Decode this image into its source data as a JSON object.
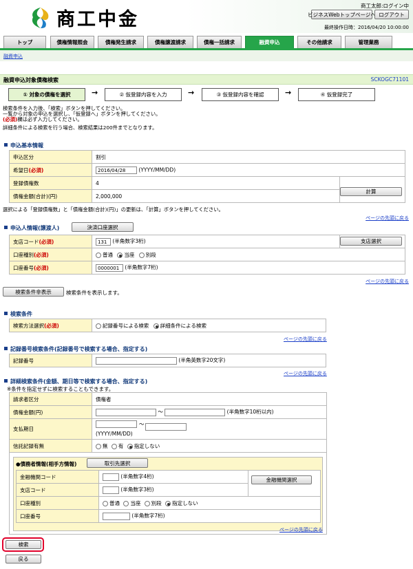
{
  "header": {
    "logo_text": "商工中金",
    "user_text": "商工太郎:ログイン中",
    "top_page_button": "ビジネスWebトップページへ",
    "logout_button": "ログアウト",
    "last_operation": "最終操作日時：2016/04/20 10:00:00"
  },
  "tabs": [
    "トップ",
    "債権情報照会",
    "債権発生請求",
    "債権譲渡請求",
    "債権一括請求",
    "融資申込",
    "その他請求",
    "管理業務"
  ],
  "active_tab": "融資申込",
  "breadcrumb": "融資申込",
  "page": {
    "title": "融資申込対象債権検索",
    "screen_id": "SCKOGC71101"
  },
  "steps": [
    "① 対象の債権を選択",
    "② 仮登録内容を入力",
    "③ 仮登録内容を確認",
    "④ 仮登録完了"
  ],
  "instructions": {
    "line1": "検索条件を入力後、「検索」ボタンを押してください。",
    "line2": "一覧から対象の申込を選択し、「仮登録へ」ボタンを押してください。",
    "line3_req": "(必須)",
    "line3_rest": "欄は必ず入力してください。",
    "line4": "詳細条件による検索を行う場合、検索結果は200件までとなります。"
  },
  "basic": {
    "section": "申込基本情報",
    "kubun_label": "申込区分",
    "kubun_value": "割引",
    "date_label": "希望日",
    "date_value": "2016/04/28",
    "date_hint": "(YYYY/MM/DD)",
    "count_label": "登録債権数",
    "count_value": "4",
    "amount_label": "債権金額(合計)(円)",
    "amount_value": "2,000,000",
    "calc_button": "計算",
    "note": "選択による「登録債権数」と「債権金額(合計)(円)」の更新は、「計算」ボタンを押してください。"
  },
  "req_mark": "(必須)",
  "page_top_link": "ページの先頭に戻る",
  "applicant": {
    "section": "申込人情報(譲渡人)",
    "account_select_button": "決済口座選択",
    "branch_label": "支店コード",
    "branch_value": "131",
    "branch_hint": "(半角数字3桁)",
    "branch_select_button": "支店選択",
    "acct_type_label": "口座種別",
    "acct_types": [
      "普通",
      "当座",
      "別段"
    ],
    "acct_no_label": "口座番号",
    "acct_no_value": "0000001",
    "acct_no_hint": "(半角数字7桁)"
  },
  "toggle": {
    "button": "検索条件非表示",
    "text": "検索条件を表示します。"
  },
  "search": {
    "section": "検索条件",
    "method_label": "検索方法選択",
    "method_options": [
      "記録番号による検索",
      "詳細条件による検索"
    ]
  },
  "record": {
    "section": "記録番号検索条件(記録番号で検索する場合、指定する)",
    "label": "記録番号",
    "hint": "(半角英数字20文字)"
  },
  "detail": {
    "section": "詳細検索条件(金額、期日等で検索する場合、指定する)",
    "note": "※条件を指定せずに検索することもできます。",
    "requester_label": "請求者区分",
    "requester_value": "債権者",
    "amount_label": "債権金額(円)",
    "amount_hint": "(半角数字10桁以内)",
    "tilde": "〜",
    "due_label": "支払期日",
    "due_hint": "(YYYY/MM/DD)",
    "trust_label": "信託記録有無",
    "trust_options": [
      "無",
      "有",
      "指定しない"
    ],
    "counterparty_title": "●債務者情報(相手方情報)",
    "counterparty_button": "取引先選択",
    "bank_label": "金融機関コード",
    "bank_hint": "(半角数字4桁)",
    "bank_select_button": "金融機関選択",
    "cbranch_label": "支店コード",
    "cbranch_hint": "(半角数字3桁)",
    "cacct_type_label": "口座種別",
    "cacct_types": [
      "普通",
      "当座",
      "別段",
      "指定しない"
    ],
    "cacct_no_label": "口座番号",
    "cacct_no_hint": "(半角数字7桁)"
  },
  "footer": {
    "search_button": "検索",
    "back_button": "戻る"
  }
}
